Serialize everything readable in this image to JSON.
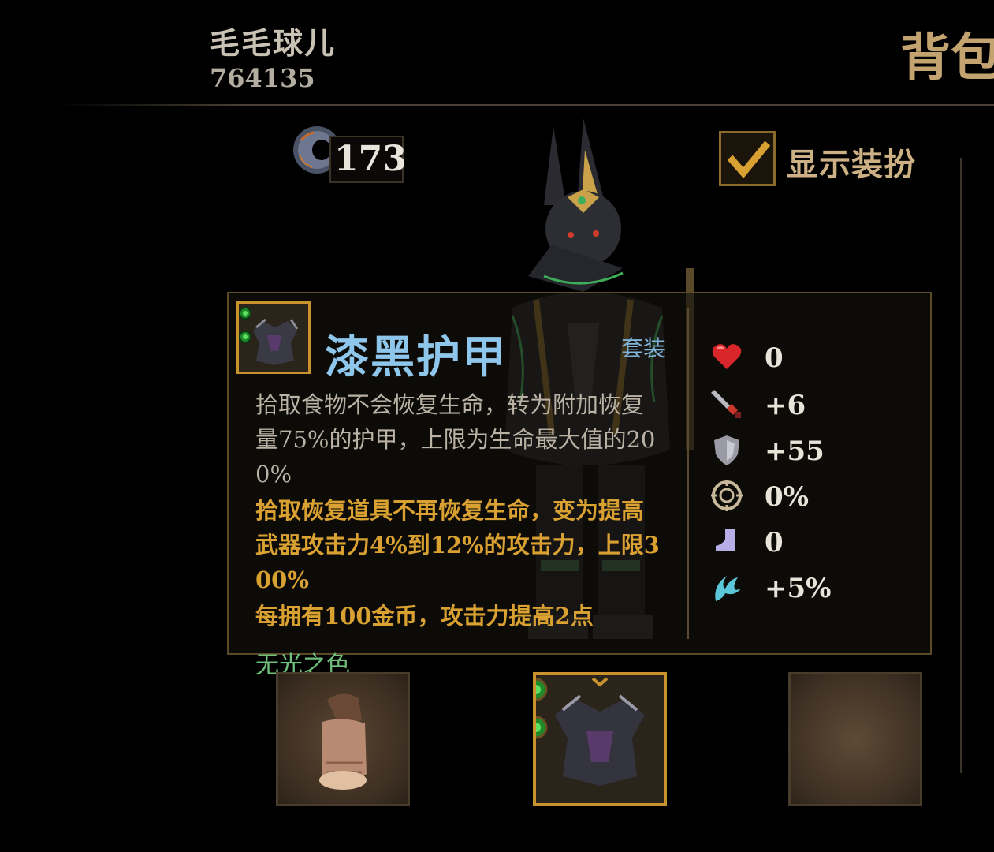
{
  "player": {
    "name": "毛毛球儿",
    "id": "764135"
  },
  "page_title": "背包",
  "currency": {
    "icon": "ring-icon",
    "value": "173"
  },
  "costume_toggle": {
    "label": "显示装扮",
    "checked": true
  },
  "item": {
    "name": "漆黑护甲",
    "tag": "套装",
    "gem_sockets": 2,
    "description_lines": [
      "拾取食物不会恢复生命，转为附加恢复",
      "量75%的护甲，上限为生命最大值的20",
      "0%"
    ],
    "effect_lines": [
      "拾取恢复道具不再恢复生命，变为提高",
      "武器攻击力4%到12%的攻击力，上限3",
      "00%",
      "每拥有100金币，攻击力提高2点"
    ],
    "quality": "无光之色"
  },
  "stats": [
    {
      "icon": "heart-icon",
      "value": "0"
    },
    {
      "icon": "sword-icon",
      "value": "+6"
    },
    {
      "icon": "shield-icon",
      "value": "+55"
    },
    {
      "icon": "crit-target-icon",
      "value": "0%"
    },
    {
      "icon": "boot-icon",
      "value": "0"
    },
    {
      "icon": "claw-icon",
      "value": "+5%"
    }
  ],
  "equipment_slots": [
    {
      "icon": "gauntlet-icon",
      "equipped": true
    },
    {
      "icon": "dark-armor-icon",
      "equipped": true,
      "selected": true
    },
    {
      "icon": "empty-slot",
      "equipped": false
    }
  ],
  "colors": {
    "background": "#000000",
    "gold_text": "#d9a032",
    "item_name_blue": "#8fc6ec",
    "quality_green": "#6fc07a",
    "frame_gold": "#c9922d"
  }
}
